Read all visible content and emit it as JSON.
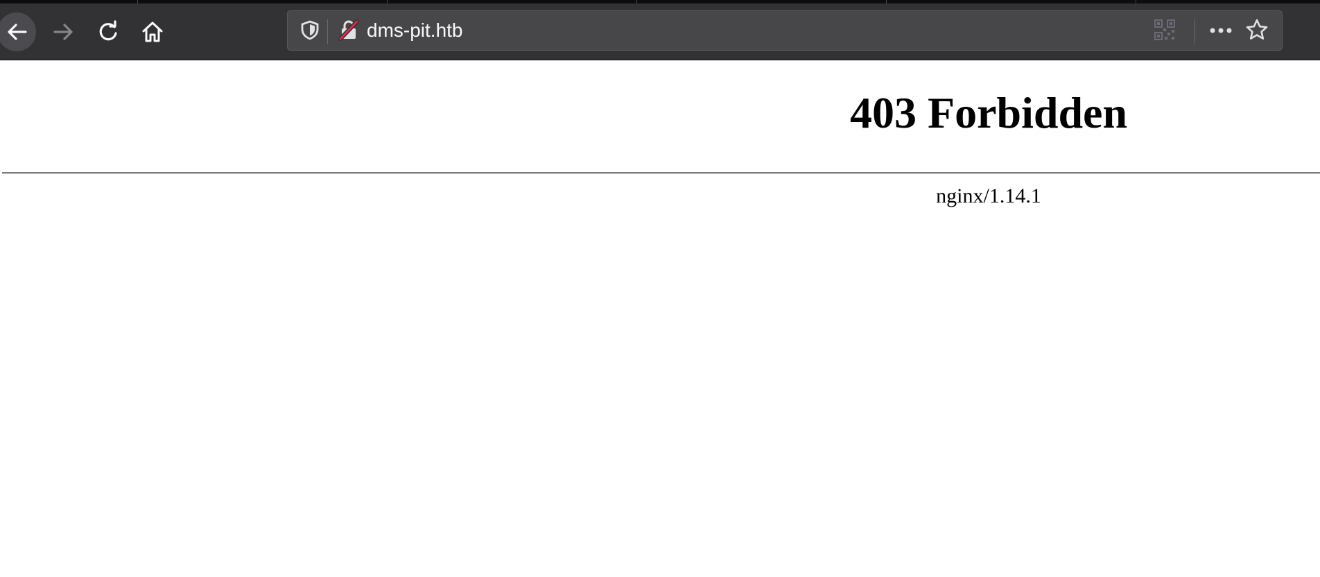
{
  "browser": {
    "url": "dms-pit.htb",
    "icons": {
      "back": "back-arrow-icon",
      "forward": "forward-arrow-icon",
      "reload": "reload-icon",
      "home": "home-icon",
      "tracking_protection": "shield-icon",
      "connection": "insecure-lock-icon",
      "qr": "qr-code-icon",
      "page_actions": "more-horizontal-icon",
      "bookmark": "star-icon"
    },
    "colors": {
      "toolbar": "#323234",
      "urlbar": "#474749",
      "insecure_accent": "#e22850"
    }
  },
  "page": {
    "heading": "403 Forbidden",
    "server_signature": "nginx/1.14.1"
  }
}
